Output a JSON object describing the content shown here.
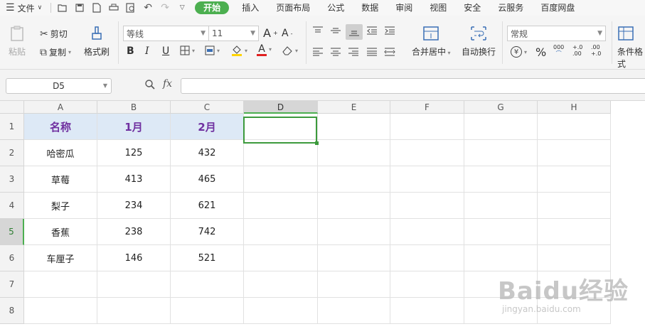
{
  "menubar": {
    "file_label": "文件",
    "tabs": [
      "开始",
      "插入",
      "页面布局",
      "公式",
      "数据",
      "审阅",
      "视图",
      "安全",
      "云服务",
      "百度网盘"
    ],
    "active_tab": "开始"
  },
  "ribbon": {
    "paste_label": "粘贴",
    "cut_label": "剪切",
    "copy_label": "复制",
    "format_painter_label": "格式刷",
    "font_name": "等线",
    "font_size": "11",
    "merge_label": "合并居中",
    "wrap_label": "自动换行",
    "number_format": "常规",
    "conditional_label": "条件格式",
    "percent_symbol": "%",
    "thousands_symbol": "000",
    "increase_decimal": "+.0 .00",
    "decrease_decimal": ".00 +.0"
  },
  "formula_bar": {
    "name_box": "D5",
    "fx_label": "fx",
    "formula": ""
  },
  "sheet": {
    "columns": [
      "A",
      "B",
      "C",
      "D",
      "E",
      "F",
      "G",
      "H"
    ],
    "rows": [
      "1",
      "2",
      "3",
      "4",
      "5",
      "6",
      "7",
      "8"
    ],
    "selected_column": "D",
    "selected_row": "5",
    "header_row": [
      "名称",
      "1月",
      "2月"
    ],
    "data": [
      [
        "哈密瓜",
        "125",
        "432"
      ],
      [
        "草莓",
        "413",
        "465"
      ],
      [
        "梨子",
        "234",
        "621"
      ],
      [
        "香蕉",
        "238",
        "742"
      ],
      [
        "车厘子",
        "146",
        "521"
      ]
    ]
  },
  "watermark": {
    "brand": "Baidu经验",
    "url": "jingyan.baidu.com"
  }
}
